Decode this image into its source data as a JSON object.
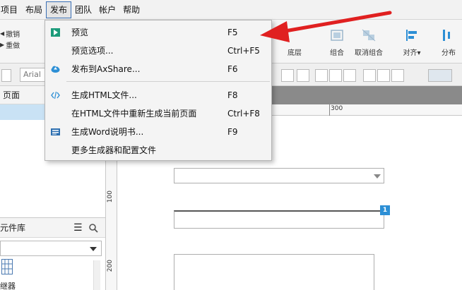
{
  "menubar": {
    "items": [
      {
        "label": "项目"
      },
      {
        "label": "布局"
      },
      {
        "label": "发布"
      },
      {
        "label": "团队"
      },
      {
        "label": "帐户"
      },
      {
        "label": "帮助"
      }
    ]
  },
  "toolbar": {
    "undo_label": "撤销",
    "redo_label": "重做",
    "bottom_layer_label": "底层",
    "group_label": "组合",
    "ungroup_label": "取消组合",
    "align_label": "对齐▾",
    "distribute_label": "分布"
  },
  "format": {
    "font_value": "Arial"
  },
  "publish_menu": {
    "items": [
      {
        "label": "预览",
        "shortcut": "F5",
        "icon": "play-icon"
      },
      {
        "label": "预览选项...",
        "shortcut": "Ctrl+F5",
        "icon": ""
      },
      {
        "label": "发布到AxShare...",
        "shortcut": "F6",
        "icon": "cloud-upload-icon"
      },
      {
        "label": "生成HTML文件...",
        "shortcut": "F8",
        "icon": "code-icon"
      },
      {
        "label": "在HTML文件中重新生成当前页面",
        "shortcut": "Ctrl+F8",
        "icon": ""
      },
      {
        "label": "生成Word说明书...",
        "shortcut": "F9",
        "icon": "word-doc-icon"
      },
      {
        "label": "更多生成器和配置文件",
        "shortcut": "",
        "icon": ""
      }
    ]
  },
  "pages_panel": {
    "title": "页面"
  },
  "library_panel": {
    "title": "元件库",
    "item_label": "继器"
  },
  "canvas": {
    "ruler_top_label": "300",
    "ruler_left_labels": [
      "100",
      "200"
    ],
    "badge_number": "1"
  },
  "colors": {
    "accent": "#2d8fd5",
    "arrow": "#e02020",
    "menu_highlight_border": "#3a6fb5"
  }
}
